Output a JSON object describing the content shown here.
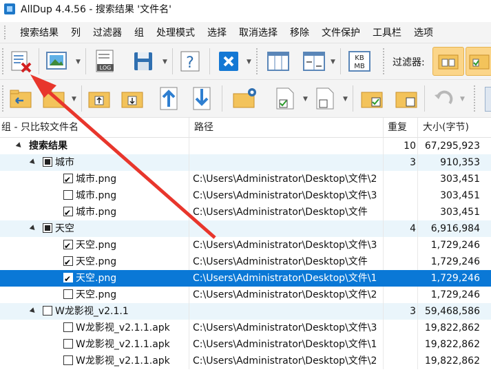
{
  "window": {
    "title": "AllDup 4.4.56 - 搜索结果 '文件名'"
  },
  "menu": [
    "搜索结果",
    "列",
    "过滤器",
    "组",
    "处理模式",
    "选择",
    "取消选择",
    "移除",
    "文件保护",
    "工具栏",
    "选项"
  ],
  "toolbar": {
    "filter_label": "过滤器:"
  },
  "table": {
    "headers": {
      "name": "组 - 只比较文件名",
      "path": "路径",
      "dup": "重复",
      "size": "大小(字节)"
    },
    "rows": [
      {
        "name": "搜索结果",
        "path": "",
        "dup": "10",
        "size": "67,295,923"
      },
      {
        "name": "城市",
        "path": "",
        "dup": "3",
        "size": "910,353"
      },
      {
        "name": "城市.png",
        "path": "C:\\Users\\Administrator\\Desktop\\文件\\2",
        "dup": "",
        "size": "303,451"
      },
      {
        "name": "城市.png",
        "path": "C:\\Users\\Administrator\\Desktop\\文件\\3",
        "dup": "",
        "size": "303,451"
      },
      {
        "name": "城市.png",
        "path": "C:\\Users\\Administrator\\Desktop\\文件",
        "dup": "",
        "size": "303,451"
      },
      {
        "name": "天空",
        "path": "",
        "dup": "4",
        "size": "6,916,984"
      },
      {
        "name": "天空.png",
        "path": "C:\\Users\\Administrator\\Desktop\\文件\\3",
        "dup": "",
        "size": "1,729,246"
      },
      {
        "name": "天空.png",
        "path": "C:\\Users\\Administrator\\Desktop\\文件",
        "dup": "",
        "size": "1,729,246"
      },
      {
        "name": "天空.png",
        "path": "C:\\Users\\Administrator\\Desktop\\文件\\1",
        "dup": "",
        "size": "1,729,246"
      },
      {
        "name": "天空.png",
        "path": "C:\\Users\\Administrator\\Desktop\\文件\\2",
        "dup": "",
        "size": "1,729,246"
      },
      {
        "name": "W龙影视_v2.1.1",
        "path": "",
        "dup": "3",
        "size": "59,468,586"
      },
      {
        "name": "W龙影视_v2.1.1.apk",
        "path": "C:\\Users\\Administrator\\Desktop\\文件\\3",
        "dup": "",
        "size": "19,822,862"
      },
      {
        "name": "W龙影视_v2.1.1.apk",
        "path": "C:\\Users\\Administrator\\Desktop\\文件\\1",
        "dup": "",
        "size": "19,822,862"
      },
      {
        "name": "W龙影视_v2.1.1.apk",
        "path": "C:\\Users\\Administrator\\Desktop\\文件\\2",
        "dup": "",
        "size": "19,822,862"
      }
    ]
  },
  "colors": {
    "selection": "#0a78d6",
    "group_row": "#eaf5fb",
    "annotation_arrow": "#e8362c"
  }
}
